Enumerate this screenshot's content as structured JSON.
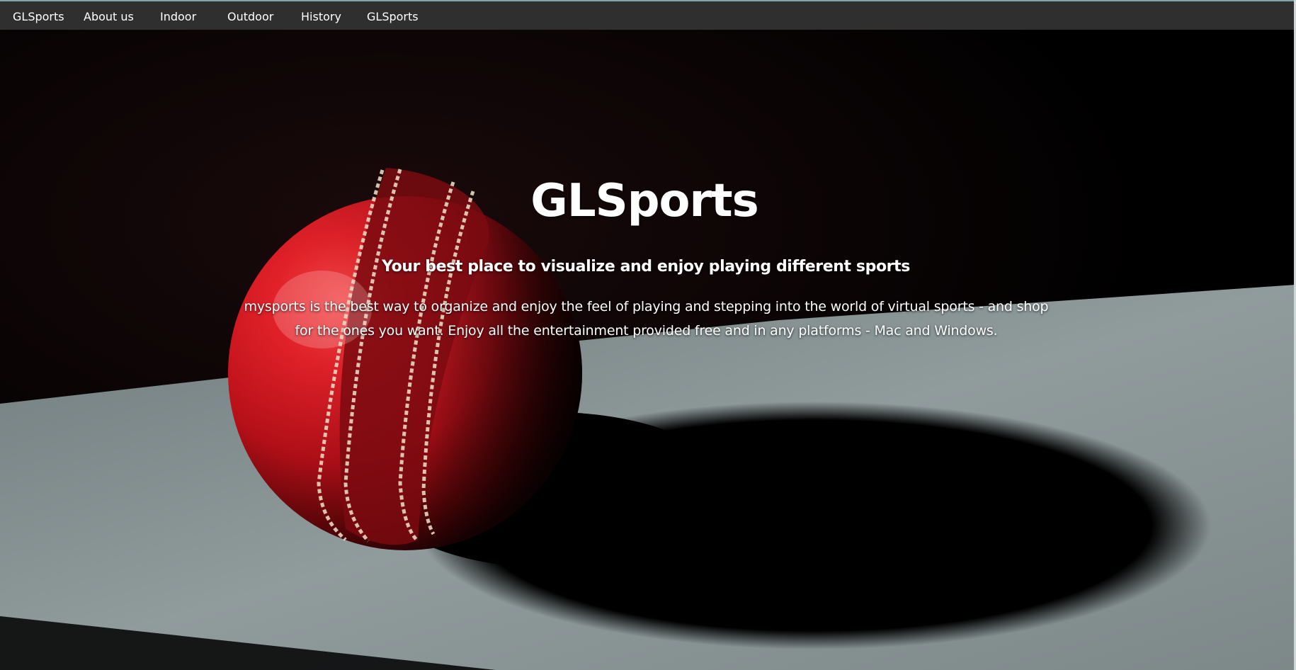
{
  "nav": {
    "items": [
      {
        "label": "GLSports"
      },
      {
        "label": "About us"
      },
      {
        "label": "Indoor"
      },
      {
        "label": "Outdoor"
      },
      {
        "label": "History"
      },
      {
        "label": "GLSports"
      }
    ]
  },
  "hero": {
    "title": "GLSports",
    "subtitle": "Your best place to visualize and enjoy playing different sports",
    "description": "mysports is the best way to organize and enjoy the feel of playing and stepping into the world of virtual sports - and shop for the ones you want. Enjoy all the entertainment provided free and in any platforms - Mac and Windows.",
    "background_image": "cricket-ball-photo"
  },
  "colors": {
    "navbar_bg": "#2f2f2f",
    "text": "#ffffff",
    "ball_red": "#c8141e",
    "floor_grey": "#8a9596"
  }
}
